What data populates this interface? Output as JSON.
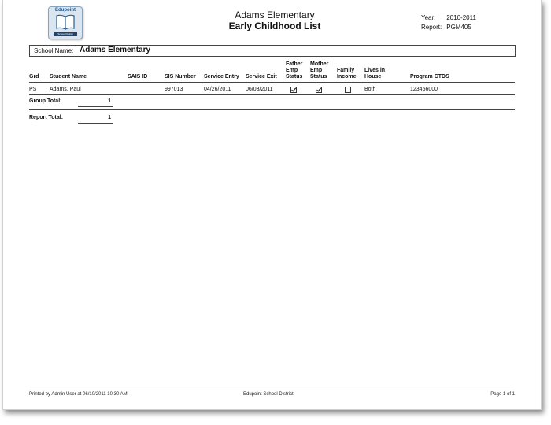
{
  "logo": {
    "brand": "Edupoint",
    "sub": "School District"
  },
  "header": {
    "school": "Adams Elementary",
    "report_title": "Early Childhood List"
  },
  "meta": {
    "year_label": "Year:",
    "year_value": "2010-2011",
    "report_label": "Report:",
    "report_value": "PGM405"
  },
  "school_bar": {
    "label": "School Name:",
    "value": "Adams Elementary"
  },
  "columns": {
    "grd": "Grd",
    "student_name": "Student Name",
    "sais_id": "SAIS ID",
    "sis_number": "SIS Number",
    "service_entry": "Service Entry",
    "service_exit": "Service Exit",
    "father_emp": [
      "Father",
      "Emp",
      "Status"
    ],
    "mother_emp": [
      "Mother",
      "Emp",
      "Status"
    ],
    "family_income": [
      "Family",
      "Income"
    ],
    "lives_in_house": [
      "Lives in",
      "House"
    ],
    "program_ctds": "Program CTDS"
  },
  "rows": [
    {
      "grd": "PS",
      "student_name": "Adams, Paul",
      "sais_id": "",
      "sis_number": "997013",
      "service_entry": "04/26/2011",
      "service_exit": "06/03/2011",
      "father_emp_checked": true,
      "mother_emp_checked": true,
      "family_income_checked": false,
      "lives_in_house": "Both",
      "program_ctds": "123456000"
    }
  ],
  "totals": {
    "group_label": "Group Total:",
    "group_value": "1",
    "report_label": "Report Total:",
    "report_value": "1"
  },
  "footer": {
    "printed_by": "Printed by Admin User at 06/10/2011 10:30 AM",
    "district": "Edupoint School District",
    "page": "Page 1 of 1"
  }
}
